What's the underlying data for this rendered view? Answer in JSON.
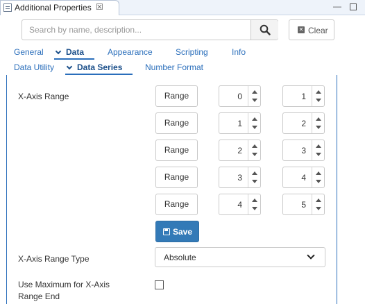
{
  "view": {
    "title": "Additional Properties",
    "close_glyph": "☒",
    "minimize_glyph": "—"
  },
  "search": {
    "placeholder": "Search by name, description...",
    "value": "",
    "clear_label": "Clear"
  },
  "tabs_row1": [
    {
      "label": "General",
      "active": false
    },
    {
      "label": "Data",
      "active": true
    },
    {
      "label": "Appearance",
      "active": false
    },
    {
      "label": "Scripting",
      "active": false
    },
    {
      "label": "Info",
      "active": false
    }
  ],
  "tabs_row2": [
    {
      "label": "Data Utility",
      "active": false
    },
    {
      "label": "Data Series",
      "active": true
    },
    {
      "label": "Number Format",
      "active": false
    }
  ],
  "form": {
    "x_axis_range_label": "X-Axis Range",
    "range_button_label": "Range",
    "ranges": [
      {
        "start": "0",
        "end": "1"
      },
      {
        "start": "1",
        "end": "2"
      },
      {
        "start": "2",
        "end": "3"
      },
      {
        "start": "3",
        "end": "4"
      },
      {
        "start": "4",
        "end": "5"
      }
    ],
    "save_label": "Save",
    "range_type_label": "X-Axis Range Type",
    "range_type_value": "Absolute",
    "use_max_label_line1": "Use Maximum for X-Axis",
    "use_max_label_line2": "Range End",
    "use_max_checked": false
  },
  "colors": {
    "accent": "#2a6ebb",
    "primary_button": "#337ab7"
  },
  "icons": [
    "view-icon",
    "close-icon",
    "minimize-icon",
    "maximize-icon",
    "search-icon",
    "clear-icon",
    "chevron-down-icon",
    "save-icon",
    "spinner-up-icon",
    "spinner-down-icon",
    "dropdown-caret-icon"
  ]
}
